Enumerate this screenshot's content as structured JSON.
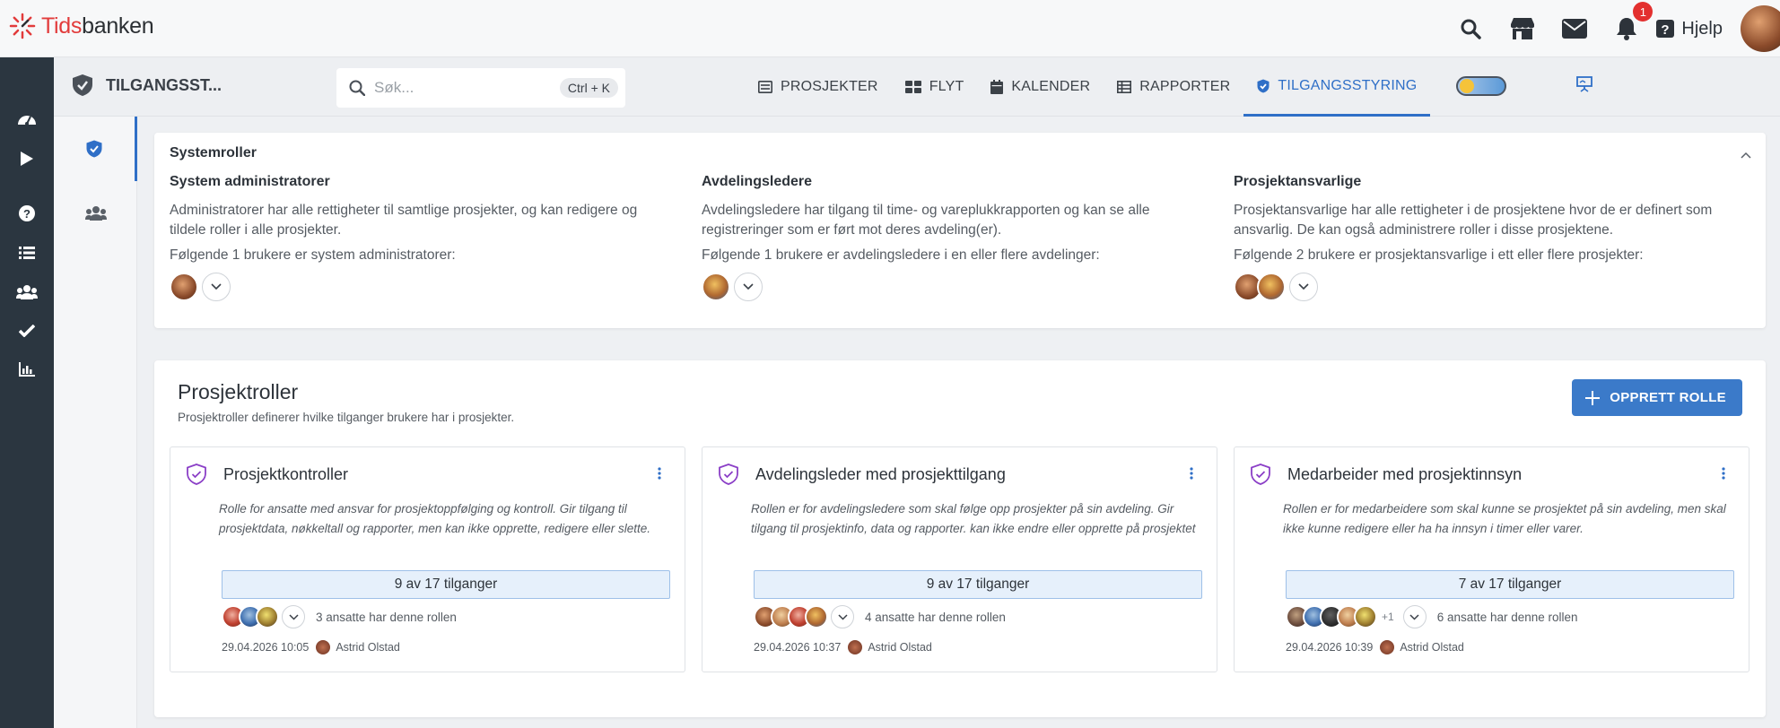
{
  "app": {
    "logo_left": "Tids",
    "logo_right": "banken",
    "help_label": "Hjelp",
    "notification_count": "1",
    "accent": "#2f6fc7"
  },
  "module": {
    "title": "TILGANGSST..."
  },
  "search": {
    "placeholder": "Søk...",
    "shortcut": "Ctrl + K"
  },
  "tabs": [
    {
      "label": "PROSJEKTER",
      "icon": "projects-icon"
    },
    {
      "label": "FLYT",
      "icon": "flow-icon"
    },
    {
      "label": "KALENDER",
      "icon": "calendar-icon"
    },
    {
      "label": "RAPPORTER",
      "icon": "reports-icon"
    },
    {
      "label": "TILGANGSSTYRING",
      "icon": "shield-check-icon",
      "active": true
    }
  ],
  "system_roles": {
    "title": "Systemroller",
    "blocks": [
      {
        "heading": "System administratorer",
        "description": "Administratorer har alle rettigheter til samtlige prosjekter, og kan redigere og tildele roller i alle prosjekter.",
        "count_text": "Følgende 1 brukere er system administratorer:"
      },
      {
        "heading": "Avdelingsledere",
        "description": "Avdelingsledere har tilgang til time- og vareplukkrapporten og kan se alle registreringer som er ført mot deres avdeling(er).",
        "count_text": "Følgende 1 brukere er avdelingsledere i en eller flere avdelinger:"
      },
      {
        "heading": "Prosjektansvarlige",
        "description": "Prosjektansvarlige har alle rettigheter i de prosjektene hvor de er definert som ansvarlig. De kan også administrere roller i disse prosjektene.",
        "count_text": "Følgende 2 brukere er prosjektansvarlige i ett eller flere prosjekter:"
      }
    ]
  },
  "project_roles": {
    "title": "Prosjektroller",
    "subtitle": "Prosjektroller definerer hvilke tilganger brukere har i prosjekter.",
    "create_label": "OPPRETT ROLLE",
    "cards": [
      {
        "title": "Prosjektkontroller",
        "description": "Rolle for ansatte med ansvar for prosjektoppfølging og kontroll. Gir tilgang til prosjektdata, nøkkeltall og rapporter, men kan ikke opprette, redigere eller slette.",
        "access": "9 av 17 tilganger",
        "users_text": "3 ansatte har denne rollen",
        "extra": "",
        "date": "29.04.2026 10:05",
        "author": "Astrid Olstad"
      },
      {
        "title": "Avdelingsleder med prosjekttilgang",
        "description": "Rollen er for avdelingsledere som skal følge opp prosjekter på sin avdeling. Gir tilgang til prosjektinfo, data og rapporter. kan ikke endre eller opprette på prosjektet",
        "access": "9 av 17 tilganger",
        "users_text": "4 ansatte har denne rollen",
        "extra": "",
        "date": "29.04.2026 10:37",
        "author": "Astrid Olstad"
      },
      {
        "title": "Medarbeider med prosjektinnsyn",
        "description": "Rollen er for medarbeidere som skal kunne se prosjektet på sin avdeling, men skal ikke kunne redigere eller ha ha innsyn i timer eller varer.",
        "access": "7 av 17 tilganger",
        "users_text": "6 ansatte har denne rollen",
        "extra": "+1",
        "date": "29.04.2026 10:39",
        "author": "Astrid Olstad"
      }
    ]
  }
}
